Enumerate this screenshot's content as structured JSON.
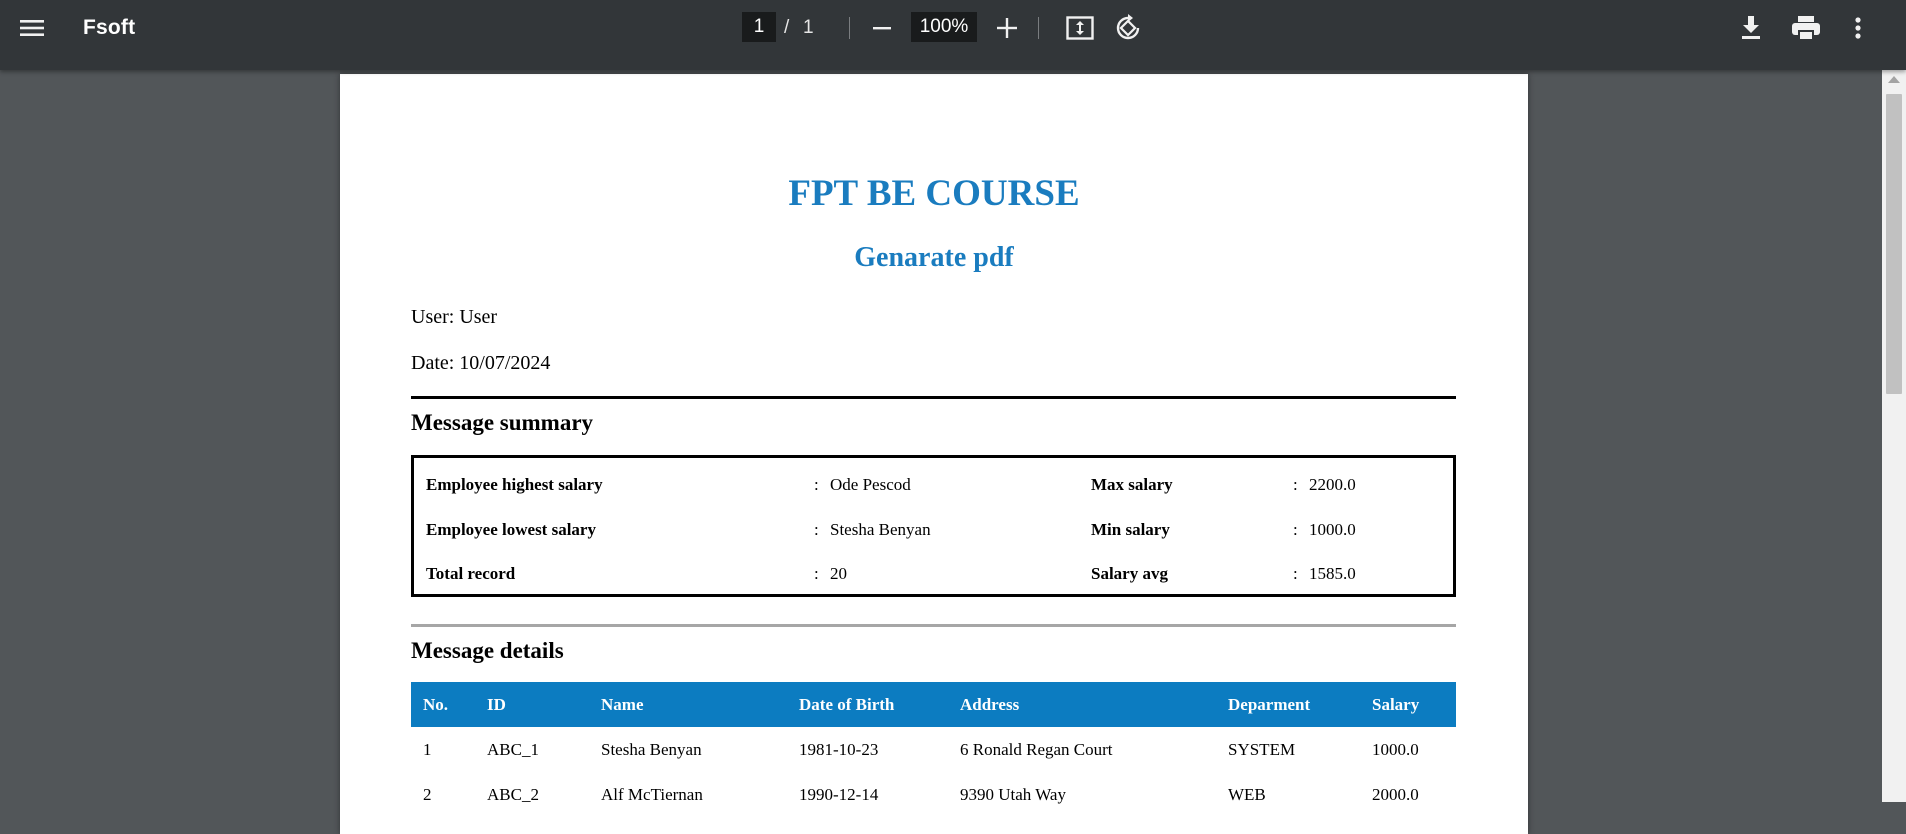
{
  "toolbar": {
    "title": "Fsoft",
    "current_page": "1",
    "page_separator": "/",
    "total_pages": "1",
    "zoom": "100%",
    "icons": [
      "menu-icon",
      "zoom-out-icon",
      "zoom-in-icon",
      "fit-page-icon",
      "rotate-icon",
      "download-icon",
      "print-icon",
      "more-options-icon"
    ]
  },
  "document": {
    "title": "FPT BE COURSE",
    "subtitle": "Genarate pdf",
    "user_line": "User: User",
    "date_line": "Date: 10/07/2024",
    "summary": {
      "heading": "Message summary",
      "rows": [
        {
          "label": "Employee highest salary",
          "value": "Ode Pescod",
          "label2": "Max salary",
          "value2": "2200.0"
        },
        {
          "label": "Employee lowest salary",
          "value": "Stesha Benyan",
          "label2": "Min salary",
          "value2": "1000.0"
        },
        {
          "label": "Total record",
          "value": "20",
          "label2": "Salary avg",
          "value2": "1585.0"
        }
      ],
      "colon": ":"
    },
    "details": {
      "heading": "Message details",
      "columns": [
        "No.",
        "ID",
        "Name",
        "Date of Birth",
        "Address",
        "Deparment",
        "Salary"
      ],
      "rows": [
        [
          "1",
          "ABC_1",
          "Stesha Benyan",
          "1981-10-23",
          "6 Ronald Regan Court",
          "SYSTEM",
          "1000.0"
        ],
        [
          "2",
          "ABC_2",
          "Alf McTiernan",
          "1990-12-14",
          "9390 Utah Way",
          "WEB",
          "2000.0"
        ]
      ]
    }
  },
  "colors": {
    "toolbar_bg": "#323639",
    "viewer_bg": "#525659",
    "accent_blue": "#1a7cbf",
    "table_header_bg": "#0c7cc1"
  }
}
